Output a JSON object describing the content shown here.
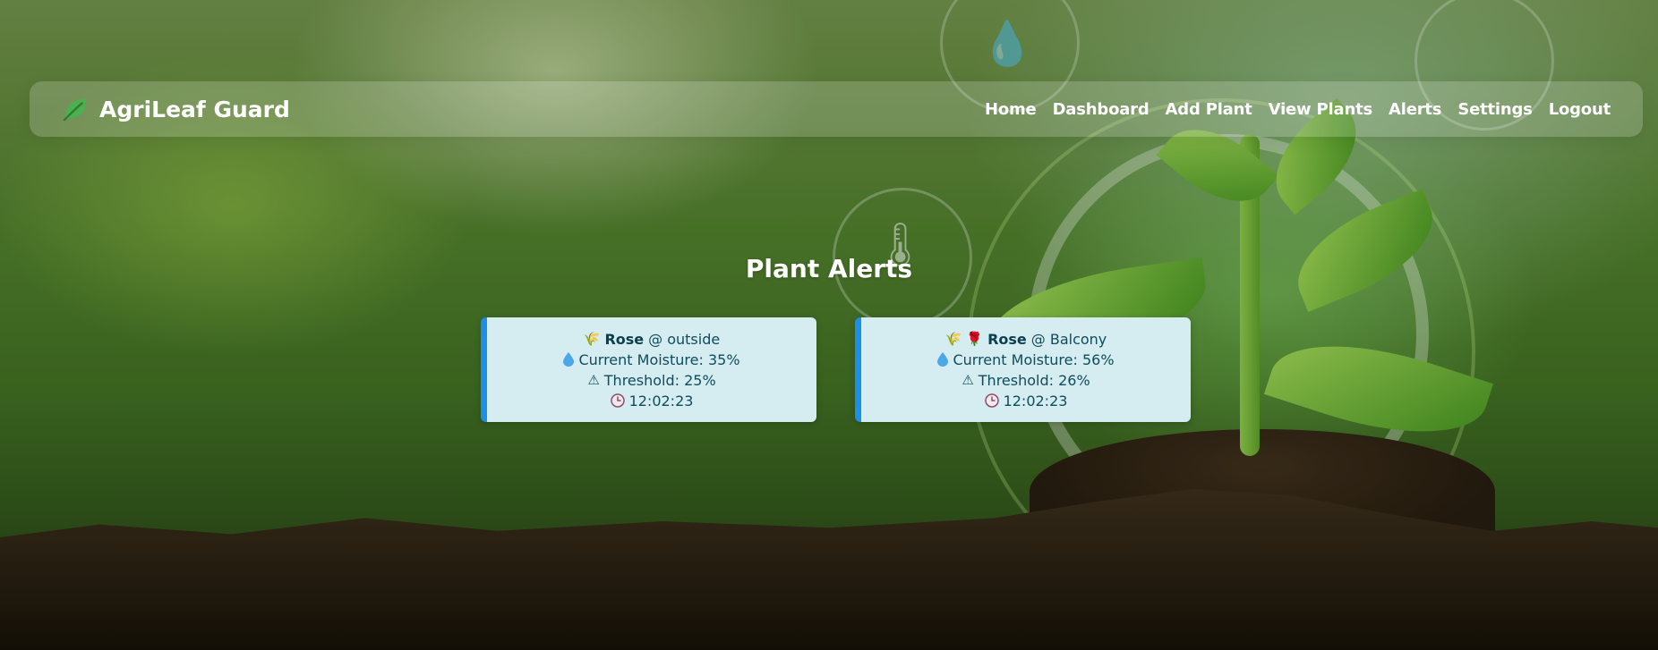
{
  "app": {
    "brand_title": "AgriLeaf Guard"
  },
  "nav": {
    "items": [
      {
        "label": "Home"
      },
      {
        "label": "Dashboard"
      },
      {
        "label": "Add Plant"
      },
      {
        "label": "View Plants"
      },
      {
        "label": "Alerts"
      },
      {
        "label": "Settings"
      },
      {
        "label": "Logout"
      }
    ]
  },
  "main": {
    "title": "Plant Alerts",
    "alerts": [
      {
        "plant_icon": "🌾",
        "extra_icon": "",
        "plant": "Rose",
        "location": "@ outside",
        "moisture": "Current Moisture: 35%",
        "threshold": "Threshold: 25%",
        "time": "12:02:23"
      },
      {
        "plant_icon": "🌾",
        "extra_icon": "🌹",
        "plant": "Rose",
        "location": "@ Balcony",
        "moisture": "Current Moisture: 56%",
        "threshold": "Threshold: 26%",
        "time": "12:02:23"
      }
    ]
  },
  "colors": {
    "accent": "#1e8fe6",
    "card_bg": "#d5ecf1",
    "card_text": "#0f4c5c",
    "brand_leaf": "#4caf50"
  },
  "icons": {
    "brand": "leaf-icon",
    "moisture": "water-drop-icon",
    "threshold": "warning-icon",
    "time": "clock-icon"
  }
}
